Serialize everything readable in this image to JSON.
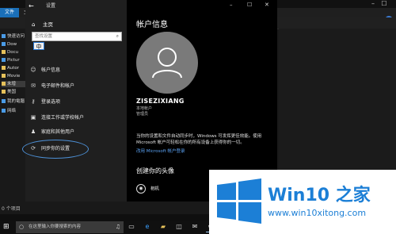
{
  "explorer": {
    "tabs": {
      "file": "文件",
      "home": "主"
    },
    "nav": [
      {
        "label": "快速访问",
        "icon": "star-icon",
        "color": "#4a9be6"
      },
      {
        "label": "Dow",
        "icon": "download-icon",
        "color": "#4a9be6"
      },
      {
        "label": "Docu",
        "icon": "document-icon",
        "color": "#e6c15a"
      },
      {
        "label": "Pictur",
        "icon": "picture-icon",
        "color": "#4a9be6"
      },
      {
        "label": "Autor",
        "icon": "folder-icon",
        "color": "#e6c15a"
      },
      {
        "label": "Movie",
        "icon": "folder-icon",
        "color": "#e6c15a"
      },
      {
        "label": "未增",
        "icon": "folder-icon",
        "color": "#e6c15a"
      },
      {
        "label": "美国",
        "icon": "folder-icon",
        "color": "#e6c15a"
      },
      {
        "label": "我的電腦",
        "icon": "computer-icon",
        "color": "#4a9be6"
      },
      {
        "label": "网络",
        "icon": "network-icon",
        "color": "#4a9be6"
      }
    ],
    "status": "0 个项目"
  },
  "settings": {
    "title": "设置",
    "home": "主页",
    "search_placeholder": "查找设置",
    "ime": "中",
    "nav": [
      {
        "label": "帐户信息",
        "icon": "person-icon",
        "glyph": "☺"
      },
      {
        "label": "电子邮件和帐户",
        "icon": "mail-icon",
        "glyph": "✉"
      },
      {
        "label": "登录选项",
        "icon": "key-icon",
        "glyph": "⚷"
      },
      {
        "label": "连接工作或学校帐户",
        "icon": "briefcase-icon",
        "glyph": "▣"
      },
      {
        "label": "家庭和其他用户",
        "icon": "family-icon",
        "glyph": "♟"
      },
      {
        "label": "同步你的设置",
        "icon": "sync-icon",
        "glyph": "⟳"
      }
    ],
    "main": {
      "heading": "帐户信息",
      "account_name": "ZISEZIXIANG",
      "account_type": "本地帐户",
      "account_role": "管理员",
      "sync_note": "当你的设置和文件自动同步时，Windows 可发挥更佳效能。使用 Microsoft 帐户可轻松在你的所有设备上获得你的一切。",
      "ms_link": "改用 Microsoft 帐户登录",
      "create_avatar_heading": "创建你的头像",
      "camera_label": "相机"
    }
  },
  "taskbar": {
    "search_placeholder": "在这里输入你要搜索的内容",
    "icons": [
      "task-view-icon",
      "edge-icon",
      "explorer-icon",
      "store-icon",
      "mail-icon",
      "settings-icon"
    ]
  },
  "watermark": {
    "title": "Win10 之家",
    "url": "www.win10xitong.com"
  },
  "colors": {
    "accent": "#1c7fd6",
    "link": "#5aa0f0",
    "ellipse": "#4d90d6"
  }
}
